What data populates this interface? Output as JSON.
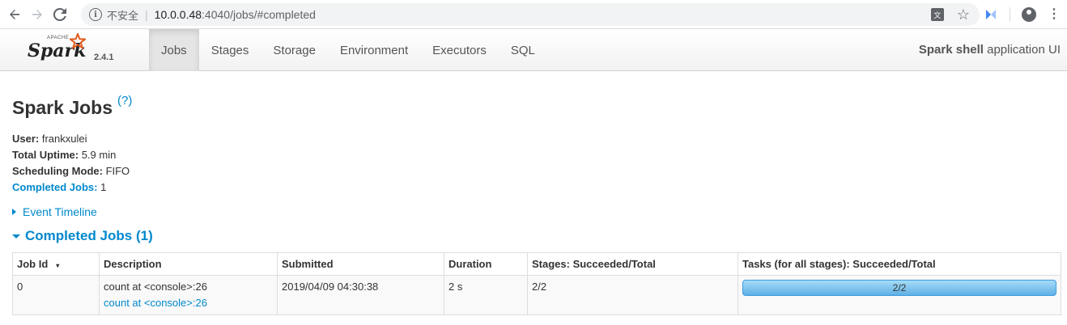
{
  "browser": {
    "back_icon": "arrow-left-icon",
    "forward_icon": "arrow-right-icon",
    "reload_icon": "reload-icon",
    "security_label": "不安全",
    "url_host": "10.0.0.48",
    "url_rest": ":4040/jobs/#completed"
  },
  "navbar": {
    "logo_text": "Spark",
    "logo_apache": "APACHE",
    "version": "2.4.1",
    "tabs": [
      {
        "label": "Jobs",
        "active": true
      },
      {
        "label": "Stages"
      },
      {
        "label": "Storage"
      },
      {
        "label": "Environment"
      },
      {
        "label": "Executors"
      },
      {
        "label": "SQL"
      }
    ],
    "app_name_bold": "Spark shell",
    "app_name_rest": " application UI"
  },
  "page": {
    "title": "Spark Jobs",
    "help": "(?)",
    "summary": {
      "user_label": "User:",
      "user_value": " frankxulei",
      "uptime_label": "Total Uptime:",
      "uptime_value": " 5.9 min",
      "mode_label": "Scheduling Mode:",
      "mode_value": " FIFO",
      "completed_label": "Completed Jobs:",
      "completed_value": " 1"
    },
    "event_timeline": "Event Timeline",
    "completed_section": "Completed Jobs (1)"
  },
  "table": {
    "headers": [
      "Job Id",
      "Description",
      "Submitted",
      "Duration",
      "Stages: Succeeded/Total",
      "Tasks (for all stages): Succeeded/Total"
    ],
    "sort_indicator": "▾",
    "rows": [
      {
        "job_id": "0",
        "description": "count at <console>:26",
        "description_link": "count at <console>:26",
        "submitted": "2019/04/09 04:30:38",
        "duration": "2 s",
        "stages": "2/2",
        "tasks": "2/2",
        "tasks_progress": 1.0
      }
    ]
  }
}
